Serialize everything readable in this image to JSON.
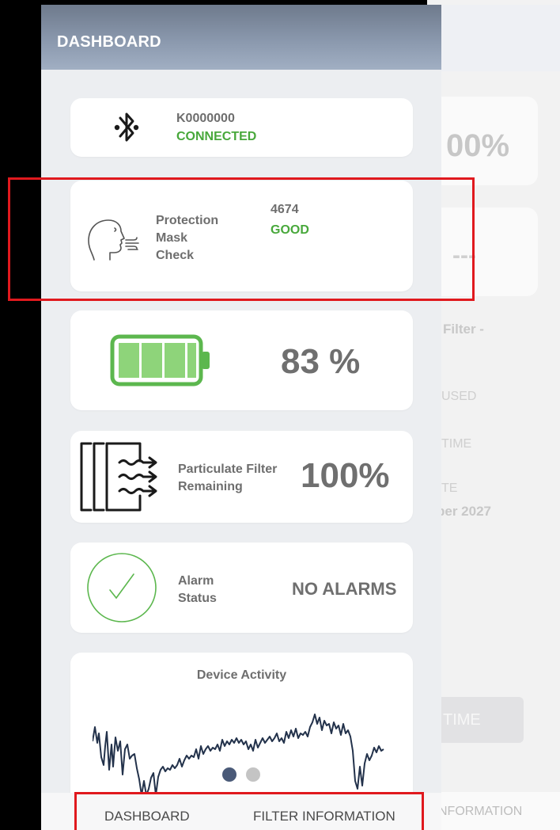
{
  "drawer": {
    "title": "DASHBOARD"
  },
  "device": {
    "icon": "bluetooth-icon",
    "id": "K0000000",
    "status": "CONNECTED"
  },
  "mask_check": {
    "icon": "breathing-face-icon",
    "label_line1": "Protection",
    "label_line2": "Mask",
    "label_line3": "Check",
    "value": "4674",
    "status": "GOOD"
  },
  "battery": {
    "icon": "battery-icon",
    "value_text": "83 %",
    "level_percent": 83
  },
  "filter": {
    "icon": "particulate-filter-icon",
    "label_line1": "Particulate Filter",
    "label_line2": "Remaining",
    "value": "100%"
  },
  "alarm": {
    "icon": "check-circle-icon",
    "label_line1": "Alarm",
    "label_line2": "Status",
    "value": "NO ALARMS"
  },
  "activity": {
    "title": "Device Activity",
    "page_count": 2,
    "active_page": 1
  },
  "tabs": {
    "dashboard": "DASHBOARD",
    "filter_information": "FILTER INFORMATION"
  },
  "background_page": {
    "percent": "00%",
    "dashes": "---",
    "filter_label": "Filter -",
    "used_label": "USED",
    "time_label": "TIME",
    "date_label": "TE",
    "date_value": "ber 2027",
    "button_label": "TIME",
    "tab_label": "NFORMATION"
  },
  "colors": {
    "accent_green": "#48a83b",
    "header": "#8a98ad",
    "highlight_red": "#e0191e",
    "dot_active": "#4a5a78",
    "dot_inactive": "#c4c4c4"
  }
}
